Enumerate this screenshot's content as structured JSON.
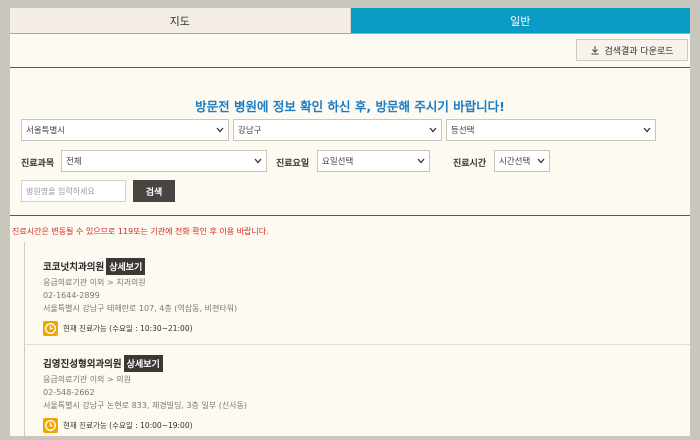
{
  "tabs": [
    {
      "label": "지도",
      "active": false
    },
    {
      "label": "일반",
      "active": true
    }
  ],
  "toolbar": {
    "download_label": "검색결과 다운로드"
  },
  "notice_title": "방문전 병원에 정보 확인 하신 후, 방문해 주시기 바랍니다!",
  "filters": {
    "city": "서울특별시",
    "district": "강남구",
    "subway": "등선택",
    "department_label": "진료과목",
    "department": "전체",
    "day_label": "진료요일",
    "day": "요일선택",
    "time_label": "진료시간",
    "time": "시간선택",
    "name_placeholder": "병원명을 입력하세요",
    "search_label": "검색"
  },
  "warning": "진료시간은 변동될 수 있으므로 119또는 기관에 전화 확인 후 이용 바랍니다.",
  "detail_label": "상세보기",
  "hospitals": [
    {
      "name": "코코넛치과의원",
      "category": "응급의료기관 이외 > 치과의원",
      "phone": "02-1644-2899",
      "address": "서울특별시 강남구 테헤란로 107, 4층 (역삼동, 비젼타워)",
      "hours": "현재 진료가능 (수요일 : 10:30~21:00)"
    },
    {
      "name": "김영진성형외과의원",
      "category": "응급의료기관 이외 > 의원",
      "phone": "02-548-2662",
      "address": "서울특별시 강남구 논현로 833, 재경빌딩, 3층 일부 (신사동)",
      "hours": "현재 진료가능 (수요일 : 10:00~19:00)"
    }
  ],
  "colors": {
    "active_tab": "#0a9bc6",
    "title_blue": "#1a7dc4",
    "warning_red": "#dd2222",
    "clock_orange": "#f0a500"
  }
}
